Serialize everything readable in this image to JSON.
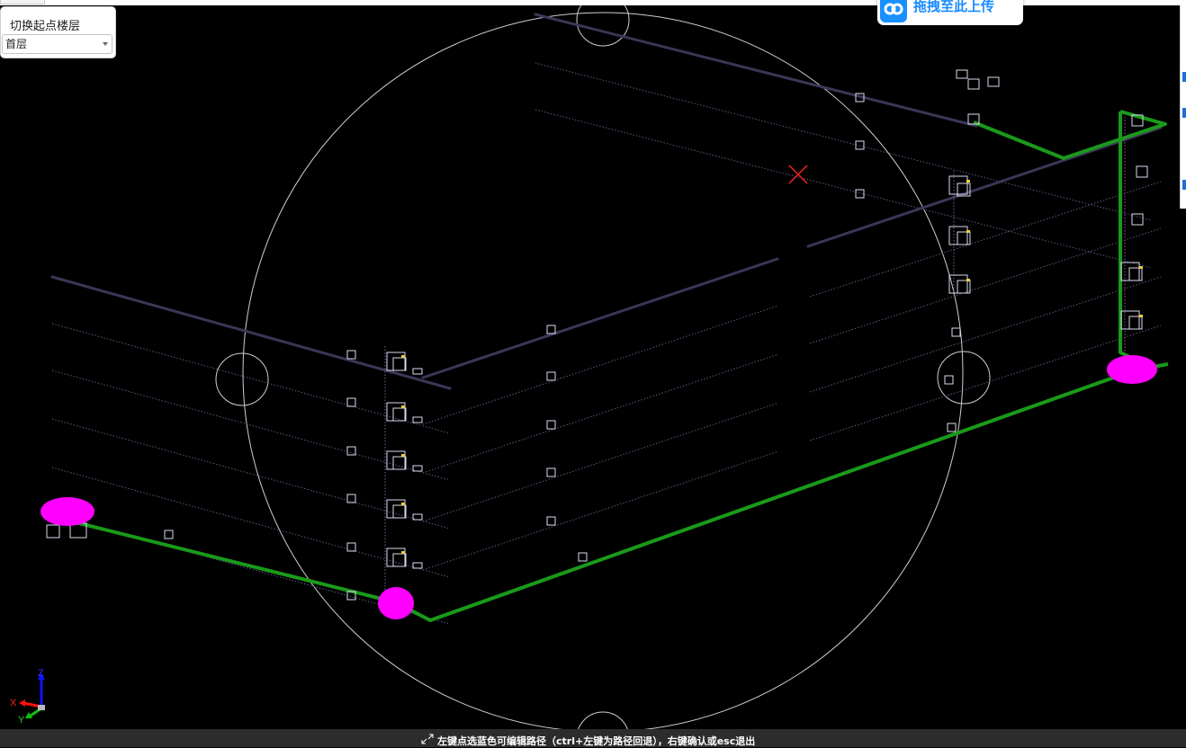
{
  "floor_switcher": {
    "title": "切换起点楼层",
    "selected": "首层"
  },
  "upload_button": {
    "label": "拖拽至此上传",
    "brand_color": "#1890ff"
  },
  "status_bar": {
    "hint": "左键点选蓝色可编辑路径（ctrl+左键为路径回退），右键确认或esc退出"
  },
  "axes": {
    "x": "X",
    "y": "Y",
    "z": "Z"
  },
  "colors": {
    "background": "#000000",
    "route_path": "#1a9a1a",
    "pipe": "#3d3556",
    "endpoint": "#ff00ff",
    "marker": "#ff2020",
    "guide_circle": "#d0d0d0"
  },
  "icons": {
    "cursor": "move-cursor-icon",
    "upload_logo": "cloud-link-icon",
    "dropdown": "chevron-down-icon"
  }
}
